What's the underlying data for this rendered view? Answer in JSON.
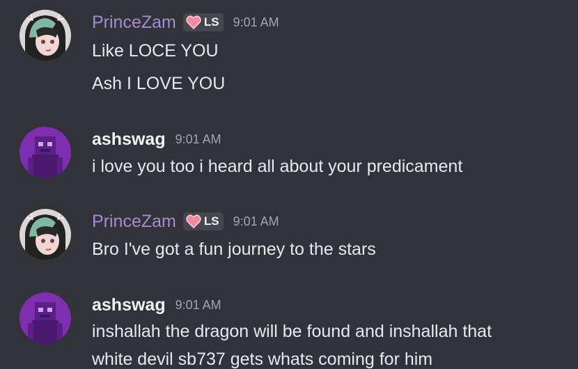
{
  "messages": [
    {
      "author": "PrinceZam",
      "badge": "LS",
      "timestamp": "9:01 AM",
      "lines": [
        "Like LOCE YOU",
        "Ash I LOVE YOU"
      ],
      "avatar": "anime-girl-avatar"
    },
    {
      "author": "ashswag",
      "timestamp": "9:01 AM",
      "lines": [
        "i love you too i heard all about your predicament"
      ],
      "avatar": "purple-minecraft-avatar"
    },
    {
      "author": "PrinceZam",
      "badge": "LS",
      "timestamp": "9:01 AM",
      "lines": [
        "Bro I've got a fun journey to the stars"
      ],
      "avatar": "anime-girl-avatar"
    },
    {
      "author": "ashswag",
      "timestamp": "9:01 AM",
      "lines": [
        "inshallah the dragon will be found and inshallah that",
        "white devil sb737 gets whats coming for him"
      ],
      "avatar": "purple-minecraft-avatar"
    }
  ],
  "colors": {
    "background": "#313338",
    "princezam_name": "#a78bd6",
    "ashswag_name": "#f2f3f5",
    "timestamp": "#a3a6ab",
    "badge_bg": "#45474d",
    "heart": "#f28aa0"
  }
}
